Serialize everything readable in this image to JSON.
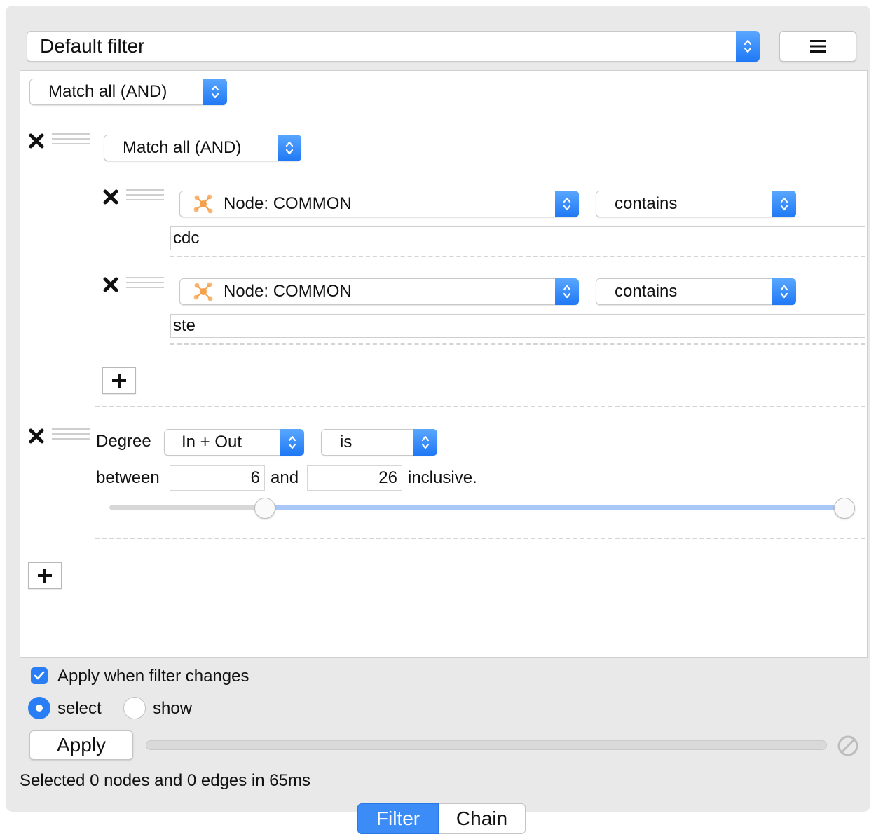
{
  "header": {
    "filter_name": "Default filter",
    "menu_icon": "hamburger-icon"
  },
  "root_group": {
    "match_mode": "Match all (AND)",
    "nested_group": {
      "match_mode": "Match all (AND)",
      "conditions": [
        {
          "column": "Node: COMMON",
          "operator": "contains",
          "value": "cdc"
        },
        {
          "column": "Node: COMMON",
          "operator": "contains",
          "value": "ste"
        }
      ]
    },
    "degree_filter": {
      "label": "Degree",
      "direction": "In + Out",
      "operator": "is",
      "between_label": "between",
      "min": "6",
      "and_label": "and",
      "max": "26",
      "inclusive_label": "inclusive.",
      "range_low_fraction": 0.2,
      "range_high_fraction": 1.0
    }
  },
  "options": {
    "apply_when_changes_label": "Apply when filter changes",
    "apply_when_changes_checked": true,
    "mode_select_label": "select",
    "mode_show_label": "show",
    "selected_mode": "select"
  },
  "actions": {
    "apply_label": "Apply",
    "cancel_icon": "cancel-icon"
  },
  "status": "Selected 0 nodes and 0 edges in 65ms",
  "tabs": [
    {
      "label": "Filter",
      "active": true
    },
    {
      "label": "Chain",
      "active": false
    }
  ],
  "colors": {
    "accent": "#2a7ef5",
    "panel_bg": "#e9e9e9",
    "node_icon": "#f5a04a"
  }
}
